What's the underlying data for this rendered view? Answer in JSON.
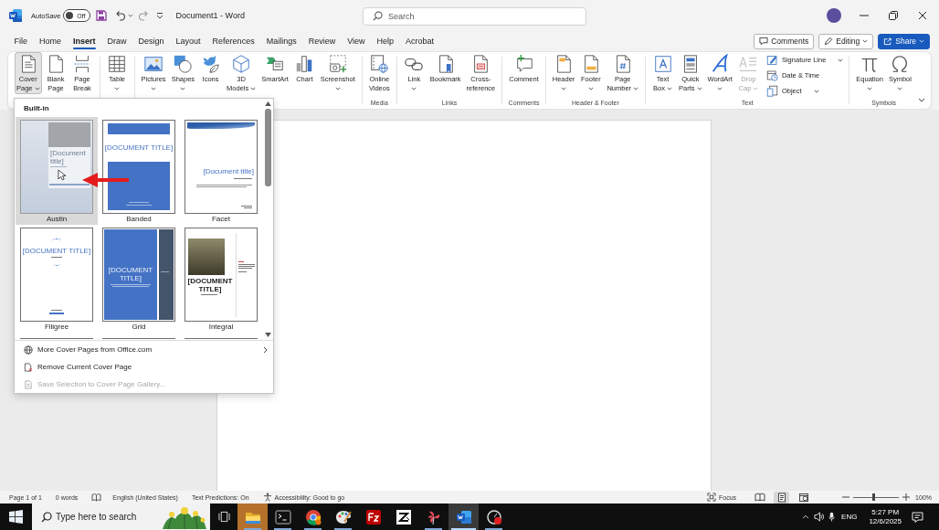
{
  "title_bar": {
    "autosave": {
      "label": "AutoSave",
      "on": false,
      "state_label": "Off"
    },
    "document_title": "Document1 - Word",
    "search": {
      "placeholder": "Search"
    }
  },
  "tabs": [
    {
      "label": "File",
      "selected": false
    },
    {
      "label": "Home",
      "selected": false
    },
    {
      "label": "Insert",
      "selected": true
    },
    {
      "label": "Draw",
      "selected": false
    },
    {
      "label": "Design",
      "selected": false
    },
    {
      "label": "Layout",
      "selected": false
    },
    {
      "label": "References",
      "selected": false
    },
    {
      "label": "Mailings",
      "selected": false
    },
    {
      "label": "Review",
      "selected": false
    },
    {
      "label": "View",
      "selected": false
    },
    {
      "label": "Help",
      "selected": false
    },
    {
      "label": "Acrobat",
      "selected": false
    }
  ],
  "tab_actions": [
    {
      "kind": "outline",
      "label": "Comments",
      "has_menu": false
    },
    {
      "kind": "outline",
      "label": "Editing",
      "has_menu": true
    },
    {
      "kind": "primary",
      "label": "Share",
      "has_menu": true
    }
  ],
  "ribbon": {
    "groups": [
      {
        "items": [
          {
            "kind": "large",
            "lines": [
              "Cover",
              "Page"
            ],
            "has_menu": true,
            "selected": true,
            "disabled": false
          },
          {
            "kind": "large",
            "lines": [
              "Blank",
              "Page"
            ],
            "has_menu": false,
            "selected": false,
            "disabled": false
          },
          {
            "kind": "large",
            "lines": [
              "Page",
              "Break"
            ],
            "has_menu": false,
            "selected": false,
            "disabled": false
          }
        ]
      },
      {
        "items": [
          {
            "kind": "large",
            "lines": [
              "Table"
            ],
            "has_menu": true,
            "selected": false,
            "disabled": false
          }
        ]
      },
      {
        "items": [
          {
            "kind": "large",
            "lines": [
              "Pictures"
            ],
            "has_menu": true,
            "selected": false,
            "disabled": false
          },
          {
            "kind": "large",
            "lines": [
              "Shapes"
            ],
            "has_menu": true,
            "selected": false,
            "disabled": false
          },
          {
            "kind": "large",
            "lines": [
              "Icons"
            ],
            "has_menu": false,
            "selected": false,
            "disabled": false
          },
          {
            "kind": "large",
            "lines": [
              "3D",
              "Models"
            ],
            "has_menu": true,
            "selected": false,
            "disabled": false
          },
          {
            "kind": "large",
            "lines": [
              "SmartArt"
            ],
            "has_menu": false,
            "selected": false,
            "disabled": false
          },
          {
            "kind": "large",
            "lines": [
              "Chart"
            ],
            "has_menu": false,
            "selected": false,
            "disabled": false
          },
          {
            "kind": "large",
            "lines": [
              "Screenshot"
            ],
            "has_menu": true,
            "selected": false,
            "disabled": false
          }
        ]
      },
      {
        "label": "Media",
        "items": [
          {
            "kind": "large",
            "lines": [
              "Online",
              "Videos"
            ],
            "has_menu": false,
            "selected": false,
            "disabled": false
          }
        ]
      },
      {
        "label": "Links",
        "items": [
          {
            "kind": "large",
            "lines": [
              "Link"
            ],
            "has_menu": true,
            "selected": false,
            "disabled": false
          },
          {
            "kind": "large",
            "lines": [
              "Bookmark"
            ],
            "has_menu": false,
            "selected": false,
            "disabled": false
          },
          {
            "kind": "large",
            "lines": [
              "Cross-",
              "reference"
            ],
            "has_menu": false,
            "selected": false,
            "disabled": false
          }
        ]
      },
      {
        "label": "Comments",
        "items": [
          {
            "kind": "large",
            "lines": [
              "Comment"
            ],
            "has_menu": false,
            "selected": false,
            "disabled": false
          }
        ]
      },
      {
        "label": "Header & Footer",
        "items": [
          {
            "kind": "large",
            "lines": [
              "Header"
            ],
            "has_menu": true,
            "selected": false,
            "disabled": false
          },
          {
            "kind": "large",
            "lines": [
              "Footer"
            ],
            "has_menu": true,
            "selected": false,
            "disabled": false
          },
          {
            "kind": "large",
            "lines": [
              "Page",
              "Number"
            ],
            "has_menu": true,
            "selected": false,
            "disabled": false
          }
        ]
      },
      {
        "label": "Text",
        "items": [
          {
            "kind": "large",
            "lines": [
              "Text",
              "Box"
            ],
            "has_menu": true,
            "selected": false,
            "disabled": false
          },
          {
            "kind": "large",
            "lines": [
              "Quick",
              "Parts"
            ],
            "has_menu": true,
            "selected": false,
            "disabled": false
          },
          {
            "kind": "large",
            "lines": [
              "WordArt"
            ],
            "has_menu": true,
            "selected": false,
            "disabled": false
          },
          {
            "kind": "large",
            "lines": [
              "Drop",
              "Cap"
            ],
            "has_menu": true,
            "selected": false,
            "disabled": true
          },
          {
            "kind": "small",
            "label": "Signature Line",
            "has_menu": true,
            "selected": false,
            "disabled": false
          },
          {
            "kind": "small",
            "label": "Date & Time",
            "has_menu": false,
            "selected": false,
            "disabled": false
          },
          {
            "kind": "small",
            "label": "Object",
            "has_menu": true,
            "selected": false,
            "disabled": false
          }
        ]
      },
      {
        "label": "Symbols",
        "items": [
          {
            "kind": "large",
            "lines": [
              "Equation"
            ],
            "has_menu": true,
            "selected": false,
            "disabled": false
          },
          {
            "kind": "large",
            "lines": [
              "Symbol"
            ],
            "has_menu": true,
            "selected": false,
            "disabled": false
          }
        ]
      }
    ]
  },
  "cover_page_menu": {
    "heading": "Built-in",
    "gallery": [
      {
        "name": "Austin",
        "preview_title": "[Document title]",
        "selected": true
      },
      {
        "name": "Banded",
        "preview_title": "[DOCUMENT TITLE]",
        "selected": false
      },
      {
        "name": "Facet",
        "preview_title": "[Document title]",
        "selected": false
      },
      {
        "name": "Filigree",
        "preview_title": "[DOCUMENT TITLE]",
        "selected": false
      },
      {
        "name": "Grid",
        "preview_title": "[DOCUMENT TITLE]",
        "selected": false
      },
      {
        "name": "Integral",
        "preview_title": "[DOCUMENT TITLE]",
        "selected": false
      }
    ],
    "commands": [
      {
        "label": "More Cover Pages from Office.com",
        "disabled": false,
        "has_submenu": true
      },
      {
        "label": "Remove Current Cover Page",
        "disabled": false,
        "has_submenu": false
      },
      {
        "label": "Save Selection to Cover Page Gallery...",
        "disabled": true,
        "has_submenu": false
      }
    ]
  },
  "status_bar": {
    "page_count": "Page 1 of 1",
    "word_count": "0 words",
    "language": "English (United States)",
    "text_predictions": "Text Predictions: On",
    "accessibility": "Accessibility: Good to go",
    "focus": "Focus",
    "views": [
      {
        "selected": false
      },
      {
        "selected": true
      },
      {
        "selected": false
      }
    ],
    "zoom": {
      "level": 0.45,
      "reading": "100%"
    }
  },
  "taskbar": {
    "search": {
      "placeholder": "Type here to search"
    },
    "apps": [
      {
        "selected": false,
        "running": true,
        "flashing": true
      },
      {
        "selected": false,
        "running": true,
        "flashing": false
      },
      {
        "selected": false,
        "running": true,
        "flashing": false
      },
      {
        "selected": false,
        "running": true,
        "flashing": false
      },
      {
        "selected": false,
        "running": false,
        "flashing": false
      },
      {
        "selected": false,
        "running": false,
        "flashing": false
      },
      {
        "selected": false,
        "running": true,
        "flashing": false
      },
      {
        "selected": true,
        "running": true,
        "flashing": false
      },
      {
        "selected": false,
        "running": true,
        "flashing": false
      }
    ],
    "language": "ENG",
    "time": "5:27 PM",
    "date": "12/6/2025"
  }
}
